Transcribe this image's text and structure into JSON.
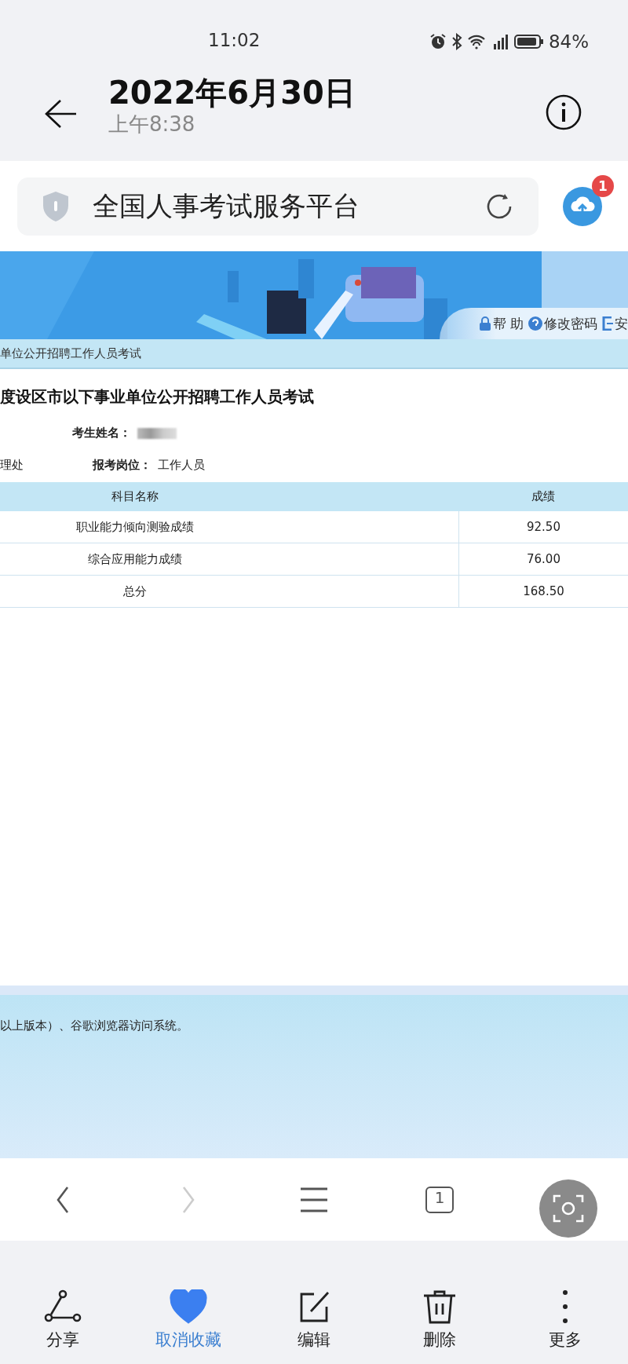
{
  "status_bar": {
    "time": "11:02",
    "battery": "84%"
  },
  "header": {
    "title": "2022年6月30日",
    "subtitle": "上午8:38"
  },
  "browser": {
    "address": "全国人事考试服务平台",
    "badge": "1"
  },
  "page": {
    "top_links": [
      {
        "kind": "lock",
        "label": "帮 助"
      },
      {
        "kind": "help",
        "label": "修改密码"
      },
      {
        "kind": "exit",
        "label": "安"
      }
    ],
    "breadcrumb": "单位公开招聘工作人员考试",
    "heading": "度设区市以下事业单位公开招聘工作人员考试",
    "name_label": "考生姓名：",
    "unit_fragment": "理处",
    "position_label": "报考岗位：",
    "position_value": "工作人员",
    "table": {
      "columns": [
        "科目名称",
        "成绩"
      ],
      "rows": [
        {
          "subject": "职业能力倾向测验成绩",
          "score": "92.50"
        },
        {
          "subject": "综合应用能力成绩",
          "score": "76.00"
        },
        {
          "subject": "总分",
          "score": "168.50"
        }
      ]
    },
    "footer_note": "以上版本）、谷歌浏览器访问系统。"
  },
  "nav": [
    {
      "kind": "back",
      "disabled": false
    },
    {
      "kind": "forward",
      "disabled": true
    },
    {
      "kind": "menu"
    },
    {
      "kind": "tabs",
      "count": "1"
    }
  ],
  "actions": [
    {
      "kind": "share",
      "label": "分享",
      "on": false
    },
    {
      "kind": "favorite",
      "label": "取消收藏",
      "on": true
    },
    {
      "kind": "edit",
      "label": "编辑",
      "on": false
    },
    {
      "kind": "delete",
      "label": "删除",
      "on": false
    },
    {
      "kind": "more",
      "label": "更多",
      "on": false
    }
  ]
}
